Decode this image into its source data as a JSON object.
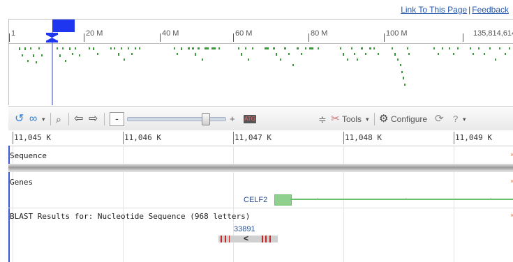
{
  "links": {
    "link_to_page": "Link To This Page",
    "separator": "|",
    "feedback": "Feedback"
  },
  "overview": {
    "labels": [
      "1",
      "20 M",
      "40 M",
      "60 M",
      "80 M",
      "100 M",
      "135,814,614"
    ],
    "handle_color": "#1f36f0",
    "feature_color": "#3a9a3a"
  },
  "toolbar": {
    "zoom_minus": "-",
    "zoom_plus": "+",
    "zoom_level": 0.82,
    "tools_label": "Tools",
    "configure_label": "Configure",
    "help_label": "?",
    "sequence_icon_text": "ATG"
  },
  "ruler": {
    "labels": [
      "11,045 K",
      "11,046 K",
      "11,047 K",
      "11,048 K",
      "11,049 K"
    ]
  },
  "tracks": {
    "sequence": "Sequence",
    "genes": "Genes",
    "gene_name": "CELF2",
    "blast_title": "BLAST Results for: Nucleotide Sequence (968 letters)",
    "blast_hit": "33891",
    "blast_arrow": "<"
  },
  "colors": {
    "gene": "#6cbf6c",
    "gene_label": "#2b4f8a",
    "blast_mismatch": "#c62828"
  }
}
